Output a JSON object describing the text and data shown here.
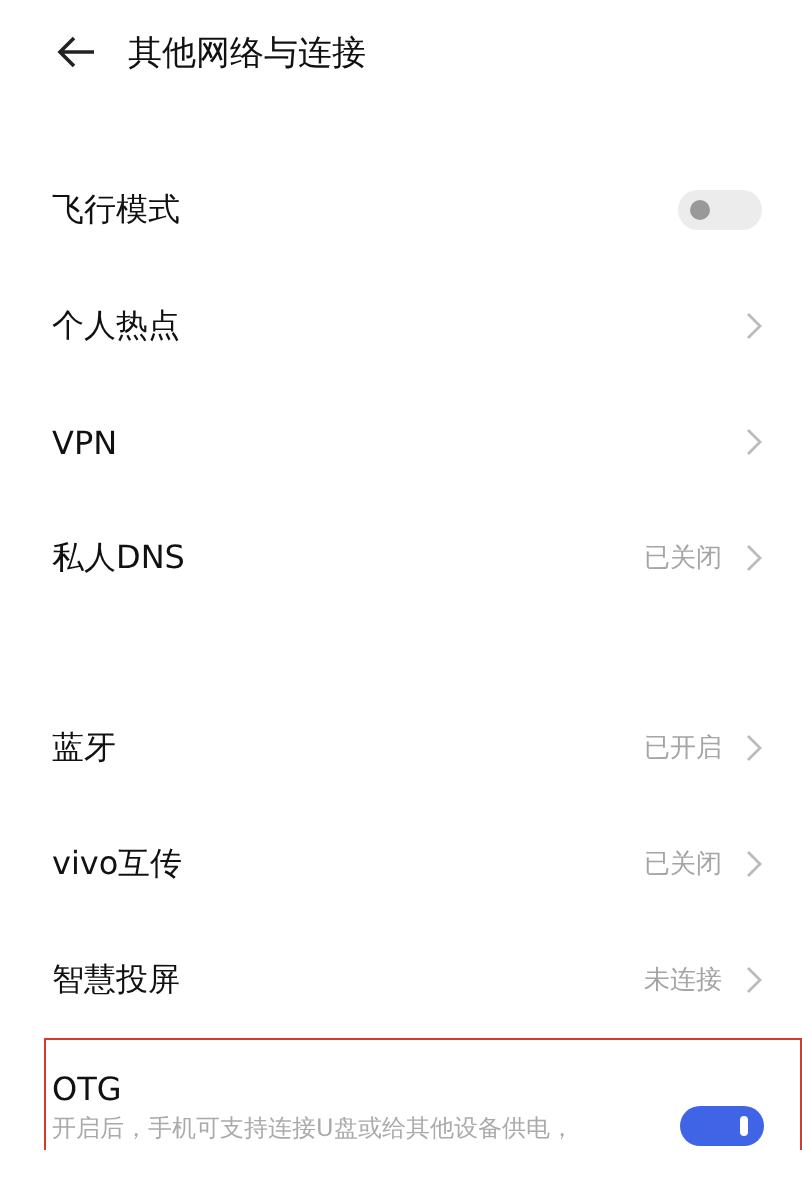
{
  "header": {
    "title": "其他网络与连接"
  },
  "groups": [
    {
      "items": [
        {
          "kind": "toggle",
          "label": "飞行模式",
          "on": false
        },
        {
          "kind": "link",
          "label": "个人热点"
        },
        {
          "kind": "link",
          "label": "VPN"
        },
        {
          "kind": "link",
          "label": "私人DNS",
          "status": "已关闭"
        }
      ]
    },
    {
      "items": [
        {
          "kind": "link",
          "label": "蓝牙",
          "status": "已开启"
        },
        {
          "kind": "link",
          "label": "vivo互传",
          "status": "已关闭"
        },
        {
          "kind": "link",
          "label": "智慧投屏",
          "status": "未连接"
        },
        {
          "kind": "toggle",
          "label": "OTG",
          "description": "开启后，手机可支持连接U盘或给其他设备供电，",
          "on": true,
          "highlighted": true
        }
      ]
    }
  ]
}
